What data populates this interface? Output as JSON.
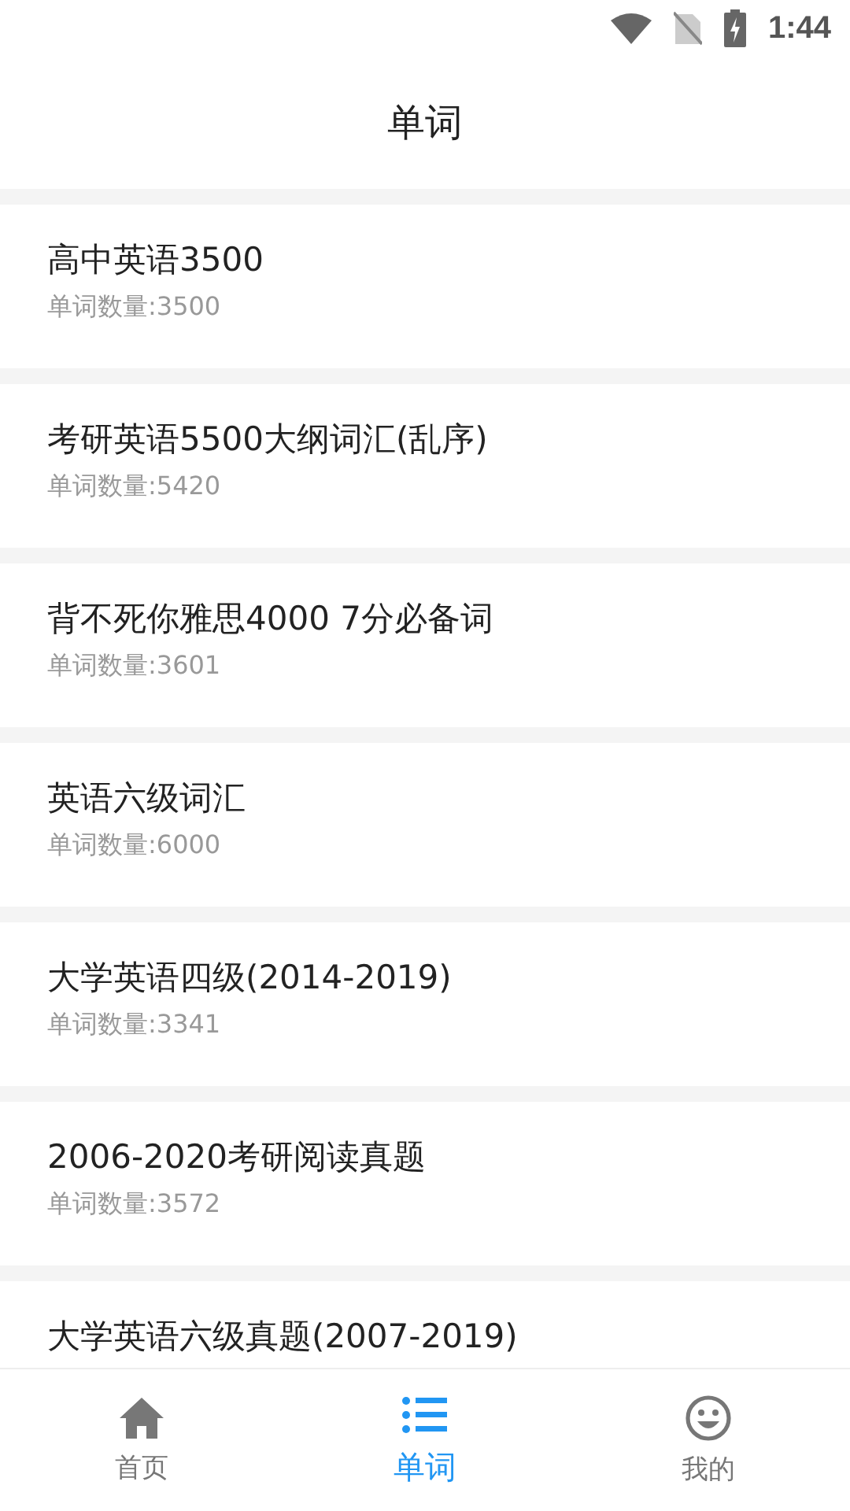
{
  "status_bar": {
    "time": "1:44"
  },
  "header": {
    "title": "单词"
  },
  "books": [
    {
      "title": "高中英语3500",
      "count": "单词数量:3500"
    },
    {
      "title": "考研英语5500大纲词汇(乱序)",
      "count": "单词数量:5420"
    },
    {
      "title": "背不死你雅思4000 7分必备词",
      "count": "单词数量:3601"
    },
    {
      "title": "英语六级词汇",
      "count": "单词数量:6000"
    },
    {
      "title": "大学英语四级(2014-2019)",
      "count": "单词数量:3341"
    },
    {
      "title": "2006-2020考研阅读真题",
      "count": "单词数量:3572"
    },
    {
      "title": "大学英语六级真题(2007-2019)"
    }
  ],
  "tabs": [
    {
      "label": "首页",
      "kind": "home",
      "selected": false
    },
    {
      "label": "单词",
      "kind": "list",
      "selected": true
    },
    {
      "label": "我的",
      "kind": "face",
      "selected": false
    }
  ]
}
